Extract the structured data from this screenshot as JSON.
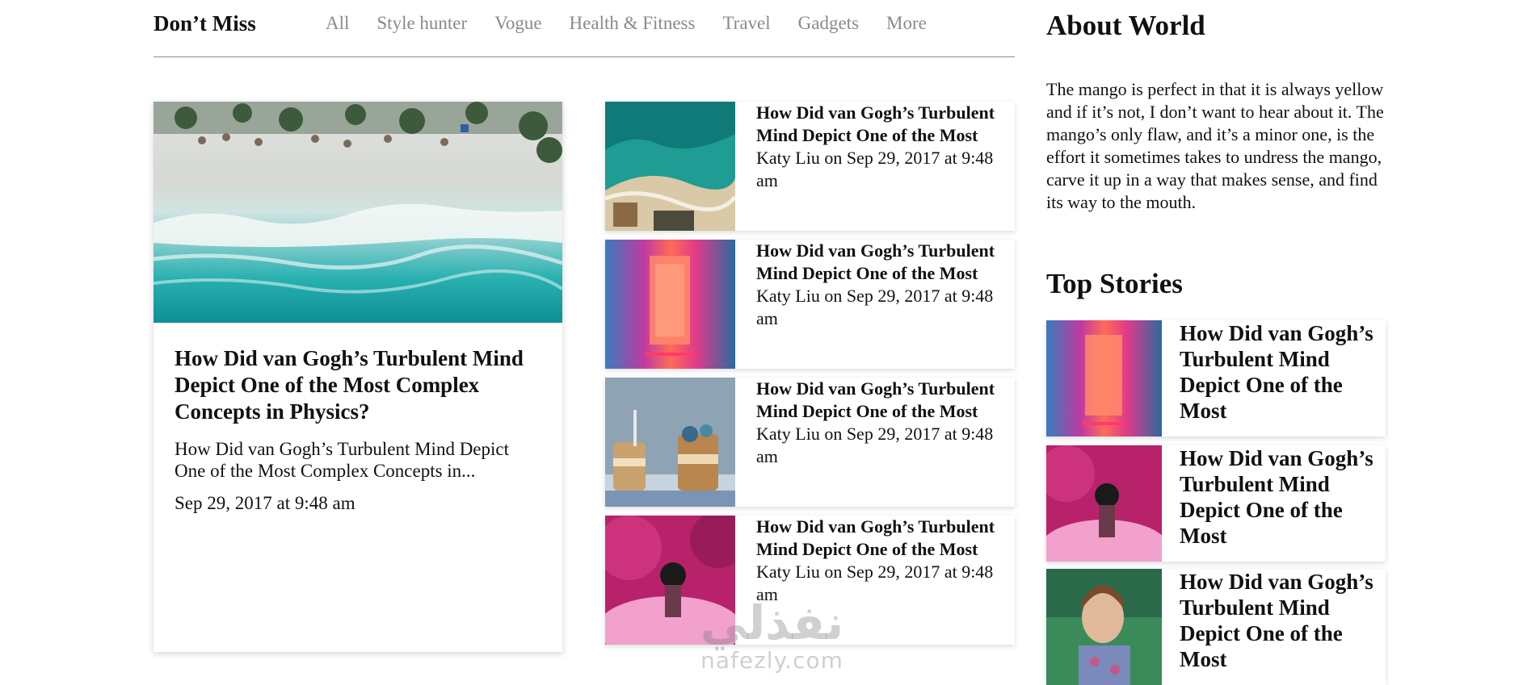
{
  "section": {
    "title": "Don’t Miss",
    "tabs": [
      "All",
      "Style hunter",
      "Vogue",
      "Health & Fitness",
      "Travel",
      "Gadgets",
      "More"
    ]
  },
  "featured": {
    "title": "How Did van Gogh’s Turbulent Mind Depict One of the Most Complex Concepts in Physics?",
    "excerpt": "How Did van Gogh’s Turbulent Mind Depict One of the Most Complex Concepts in...",
    "date": "Sep 29, 2017 at 9:48 am"
  },
  "list": [
    {
      "title": "How Did van Gogh’s Turbulent Mind Depict One of the Most",
      "meta": "Katy Liu on Sep 29, 2017 at 9:48 am"
    },
    {
      "title": "How Did van Gogh’s Turbulent Mind Depict One of the Most",
      "meta": "Katy Liu on Sep 29, 2017 at 9:48 am"
    },
    {
      "title": "How Did van Gogh’s Turbulent Mind Depict One of the Most",
      "meta": "Katy Liu on Sep 29, 2017 at 9:48 am"
    },
    {
      "title": "How Did van Gogh’s Turbulent Mind Depict One of the Most",
      "meta": "Katy Liu on Sep 29, 2017 at 9:48 am"
    }
  ],
  "about": {
    "title": "About World",
    "text": "The mango is perfect in that it is always yellow and if it’s not, I don’t want to hear about it. The mango’s only flaw, and it’s a minor one, is the effort it sometimes takes to undress the mango, carve it up in a way that makes sense, and find its way to the mouth."
  },
  "top_stories": {
    "title": "Top Stories",
    "items": [
      {
        "title": "How Did van Gogh’s Turbulent Mind Depict One of the Most"
      },
      {
        "title": "How Did van Gogh’s Turbulent Mind Depict One of the Most"
      },
      {
        "title": "How Did van Gogh’s Turbulent Mind Depict One of the Most"
      }
    ]
  },
  "watermark": {
    "arabic": "نفذلي",
    "latin": "nafezly.com"
  }
}
